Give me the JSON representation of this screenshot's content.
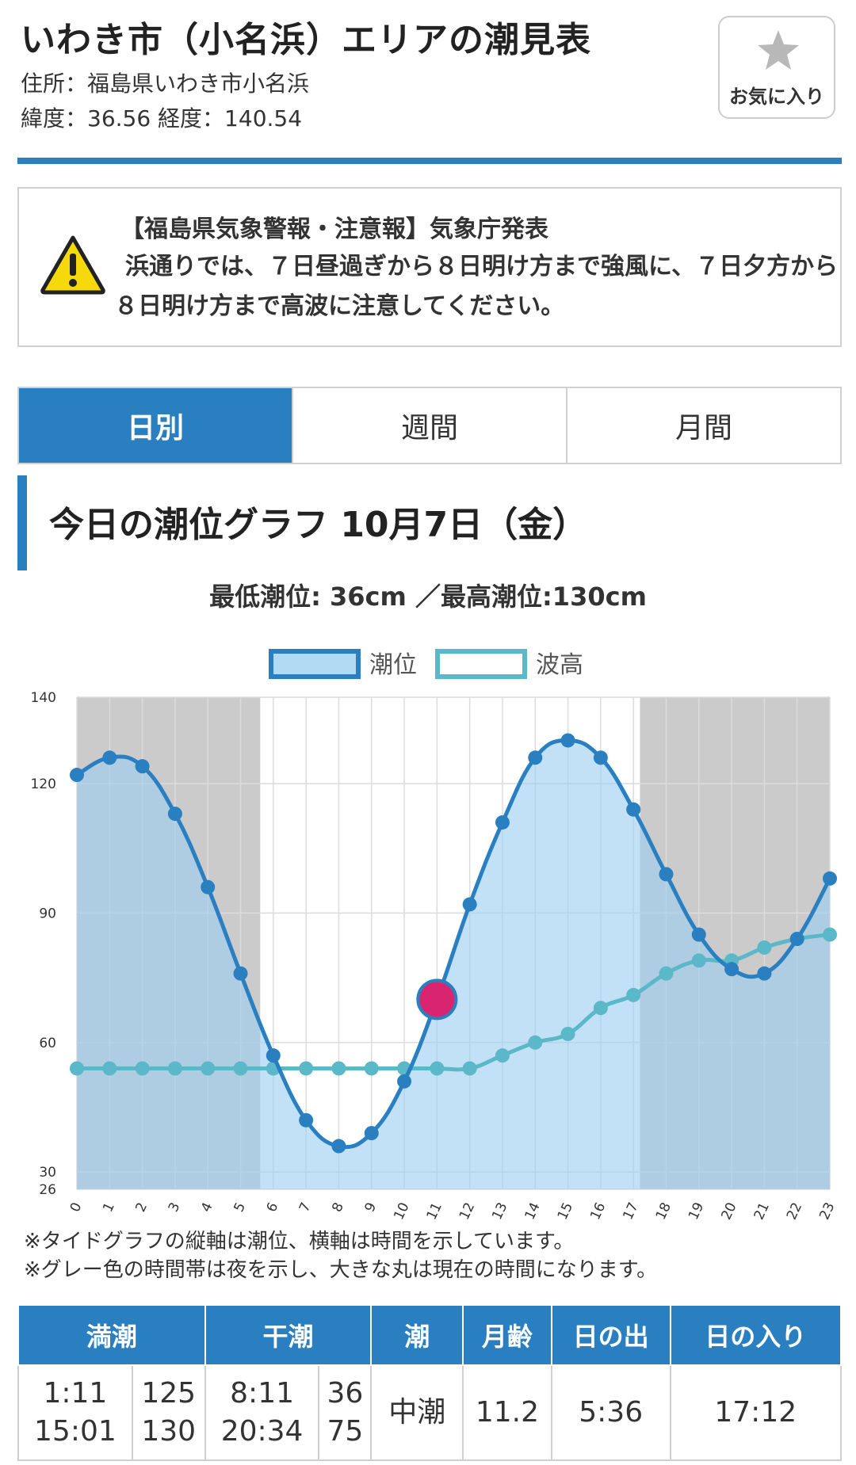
{
  "header": {
    "title": "いわき市（小名浜）エリアの潮見表",
    "address": "住所：福島県いわき市小名浜",
    "coords": "緯度：36.56  経度：140.54",
    "favorite_label": "お気に入り"
  },
  "alert": {
    "title": "【福島県気象警報・注意報】気象庁発表",
    "body": "浜通りでは、７日昼過ぎから８日明け方まで強風に、７日夕方から８日明け方まで高波に注意してください。"
  },
  "tabs": [
    {
      "label": "日別",
      "active": true
    },
    {
      "label": "週間",
      "active": false
    },
    {
      "label": "月間",
      "active": false
    }
  ],
  "section_title": "今日の潮位グラフ 10月7日（金）",
  "minmax_text": "最低潮位: 36cm ／最高潮位:130cm",
  "chart_data": {
    "type": "area",
    "x": [
      0,
      1,
      2,
      3,
      4,
      5,
      6,
      7,
      8,
      9,
      10,
      11,
      12,
      13,
      14,
      15,
      16,
      17,
      18,
      19,
      20,
      21,
      22,
      23
    ],
    "ylim": [
      26,
      140
    ],
    "yticks": [
      140,
      120,
      90,
      60,
      30,
      26
    ],
    "legend_position": "top",
    "series": [
      {
        "name": "潮位",
        "type": "area",
        "color": "#2a7fc1",
        "fill": "#b3daf3",
        "values": [
          122,
          126,
          124,
          113,
          96,
          76,
          57,
          42,
          36,
          39,
          51,
          70,
          92,
          111,
          126,
          130,
          126,
          114,
          99,
          85,
          77,
          76,
          84,
          98
        ]
      },
      {
        "name": "波高",
        "type": "line",
        "color": "#5bb8c8",
        "fill": "#ffffff",
        "values": [
          54,
          54,
          54,
          54,
          54,
          54,
          54,
          54,
          54,
          54,
          54,
          54,
          54,
          57,
          60,
          62,
          68,
          71,
          76,
          79,
          79,
          82,
          84,
          85
        ]
      }
    ],
    "night_ranges": [
      [
        0,
        5.6
      ],
      [
        17.2,
        23
      ]
    ],
    "current_time": {
      "x": 11,
      "y": 70,
      "color": "#d9256f"
    }
  },
  "notes": [
    "※タイドグラフの縦軸は潮位、横軸は時間を示しています。",
    "※グレー色の時間帯は夜を示し、大きな丸は現在の時間になります。"
  ],
  "table": {
    "headers": [
      "満潮",
      "干潮",
      "潮",
      "月齢",
      "日の出",
      "日の入り"
    ],
    "high_tide_times": [
      "1:11",
      "15:01"
    ],
    "high_tide_levels": [
      "125",
      "130"
    ],
    "low_tide_times": [
      "8:11",
      "20:34"
    ],
    "low_tide_levels": [
      "36",
      "75"
    ],
    "tide_type": "中潮",
    "moon_age": "11.2",
    "sunrise": "5:36",
    "sunset": "17:12"
  }
}
